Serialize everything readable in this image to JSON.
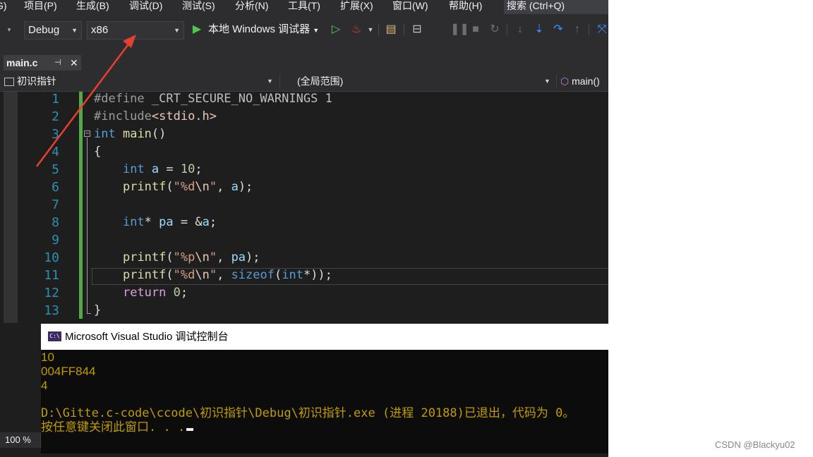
{
  "menubar": {
    "items": [
      "G)",
      "项目(P)",
      "生成(B)",
      "调试(D)",
      "测试(S)",
      "分析(N)",
      "工具(T)",
      "扩展(X)",
      "窗口(W)",
      "帮助(H)"
    ],
    "search": "搜索 (Ctrl+Q)"
  },
  "toolbar": {
    "config": "Debug",
    "platform": "x86",
    "run_label": "本地 Windows 调试器",
    "icons": [
      "play-icon",
      "hot-reload-icon",
      "folder-open-icon",
      "browse-icon",
      "pause-icon",
      "stop-icon",
      "restart-icon",
      "step-over-icon",
      "step-into-icon",
      "step-out-icon"
    ]
  },
  "tab": {
    "name": "main.c",
    "pin": "⊣",
    "close": "✕"
  },
  "navbar": {
    "project": "初识指针",
    "scope": "(全局范围)",
    "function": "main()"
  },
  "editor": {
    "line_numbers": [
      "1",
      "2",
      "3",
      "4",
      "5",
      "6",
      "7",
      "8",
      "9",
      "10",
      "11",
      "12",
      "13"
    ],
    "lines": [
      "#define _CRT_SECURE_NO_WARNINGS 1",
      "#include<stdio.h>",
      "int main()",
      "{",
      "    int a = 10;",
      "    printf(\"%d\\n\", a);",
      "",
      "    int* pa = &a;",
      "",
      "    printf(\"%p\\n\", pa);",
      "    printf(\"%d\\n\", sizeof(int*));",
      "    return 0;",
      "}"
    ]
  },
  "zoom": "100 %",
  "console": {
    "title": "Microsoft Visual Studio 调试控制台",
    "icon_label": "C:\\",
    "output": [
      "10",
      "004FF844",
      "4"
    ],
    "exit_message": "D:\\Gitte.c-code\\ccode\\初识指针\\Debug\\初识指针.exe (进程 20188)已退出，代码为 0。",
    "prompt": "按任意键关闭此窗口. . ."
  },
  "watermark": "CSDN @Blackyu02",
  "colors": {
    "annotation_arrow": "#e8402f",
    "console_text": "#c19c00",
    "keyword": "#569cd6",
    "line_number": "#2b91af"
  }
}
